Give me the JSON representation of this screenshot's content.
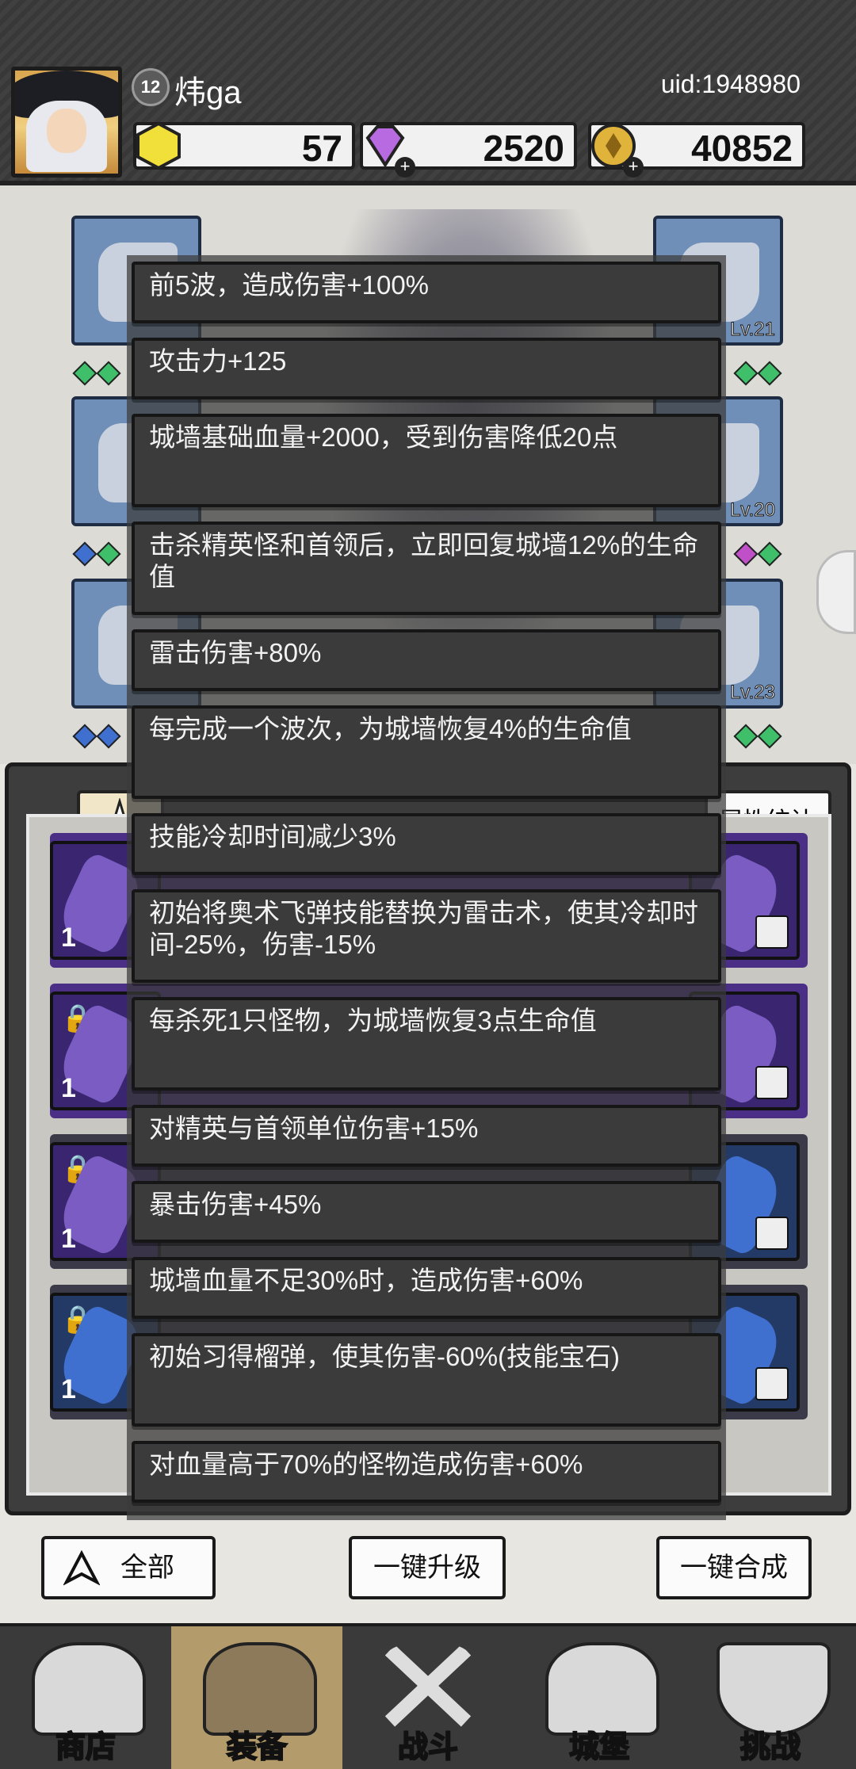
{
  "player": {
    "level": "12",
    "name": "炜ga",
    "uid": "uid:1948980"
  },
  "currencies": {
    "energy": "57",
    "gems": "2520",
    "coins": "40852"
  },
  "equipment": {
    "slot_levels": [
      "Lv.20",
      "Lv.21",
      "Lv.20",
      "Lv.23"
    ]
  },
  "inventory": {
    "stats_button": "属性统计",
    "quantities": [
      "1",
      "1",
      "1",
      "1"
    ]
  },
  "tooltip_effects": [
    "前5波，造成伤害+100%",
    "攻击力+125",
    "城墙基础血量+2000，受到伤害降低20点",
    "击杀精英怪和首领后，立即回复城墙12%的生命值",
    "雷击伤害+80%",
    "每完成一个波次，为城墙恢复4%的生命值",
    "技能冷却时间减少3%",
    "初始将奥术飞弹技能替换为雷击术，使其冷却时间-25%，伤害-15%",
    "每杀死1只怪物，为城墙恢复3点生命值",
    "对精英与首领单位伤害+15%",
    "暴击伤害+45%",
    "城墙血量不足30%时，造成伤害+60%",
    "初始习得榴弹，使其伤害-60%(技能宝石)",
    "对血量高于70%的怪物造成伤害+60%"
  ],
  "actions": {
    "filter": "全部",
    "upgrade_all": "一键升级",
    "merge_all": "一键合成"
  },
  "nav": {
    "shop": "商店",
    "equipment": "装备",
    "battle": "战斗",
    "castle": "城堡",
    "challenge": "挑战"
  },
  "colors": {
    "tooltip_bg": "#3b3b3b",
    "topbar_bg": "#3a3a3a",
    "purple_gem": "#7a5cc2",
    "blue_gem": "#3f6fcf",
    "green_gem": "#3fbf6a",
    "active_tab": "#b49b6b"
  }
}
